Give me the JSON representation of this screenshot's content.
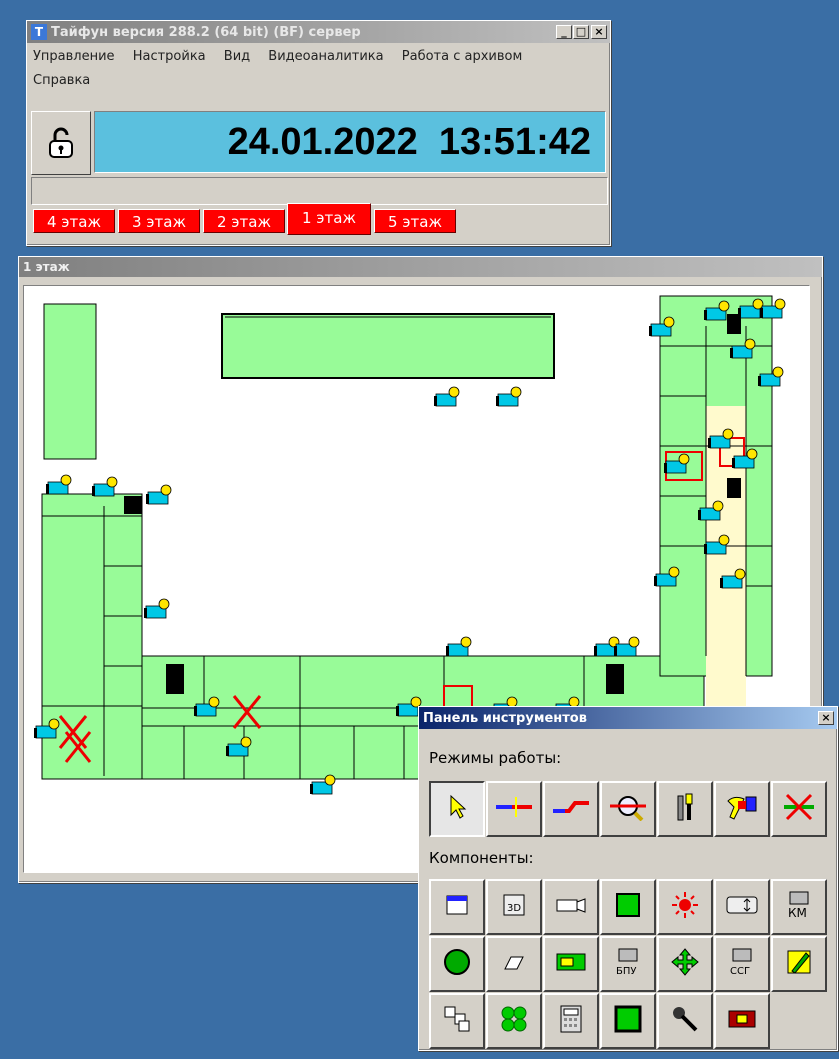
{
  "main_window": {
    "title": "Тайфун версия 288.2 (64 bit) (BF) сервер",
    "app_icon_letter": "T",
    "menu": [
      "Управление",
      "Настройка",
      "Вид",
      "Видеоаналитика",
      "Работа с архивом",
      "Справка"
    ],
    "lock_icon": "padlock-open-icon",
    "datetime": "24.01.2022  13:51:42",
    "floor_tabs": [
      "4 этаж",
      "3 этаж",
      "2 этаж",
      "1 этаж",
      "5 этаж"
    ],
    "active_floor": "1 этаж"
  },
  "map_window": {
    "title": "1 этаж"
  },
  "toolbox": {
    "title": "Панель инструментов",
    "modes_label": "Режимы работы:",
    "components_label": "Компоненты:",
    "modes": [
      "pointer-icon",
      "line-cross-icon",
      "line-connect-icon",
      "zoom-link-icon",
      "tools-icon",
      "paint-icon",
      "delete-link-icon"
    ],
    "components": [
      "window-icon",
      "3d-icon",
      "camera-icon",
      "green-square-icon",
      "alarm-light-icon",
      "card-arrows-icon",
      "km-device-icon",
      "green-button-icon",
      "eraser-icon",
      "board-icon",
      "bpu-device-icon",
      "move-icon",
      "ssg-device-icon",
      "pencil-icon",
      "network-icon",
      "four-circles-icon",
      "calculator-icon",
      "green-frame-icon",
      "microphone-icon",
      "relay-board-icon"
    ],
    "component_texts": {
      "bpu": "БПУ",
      "ssg": "ССГ",
      "km": "КМ",
      "d3": "3D"
    }
  },
  "colors": {
    "desktop": "#3a6ea5",
    "room": "#98fb98",
    "floor_tab": "#ff0000",
    "clock_panel": "#5bc0de",
    "camera": "#00c8e6",
    "camera_lens": "#ffe600"
  }
}
